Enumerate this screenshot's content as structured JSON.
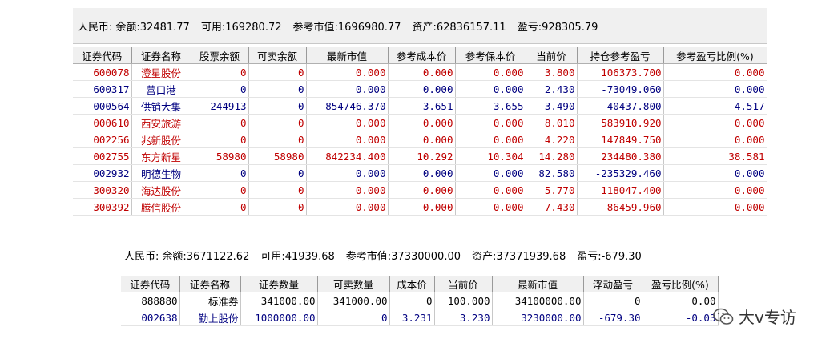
{
  "panel1": {
    "summary": {
      "currency": "人民币:",
      "balance": "余额:32481.77",
      "available": "可用:169280.72",
      "market_value": "参考市值:1696980.77",
      "assets": "资产:62836157.11",
      "profit": "盈亏:928305.79"
    },
    "headers": [
      "证券代码",
      "证券名称",
      "股票余额",
      "可卖余额",
      "最新市值",
      "参考成本价",
      "参考保本价",
      "当前价",
      "持仓参考盈亏",
      "参考盈亏比例(%)"
    ],
    "rows": [
      {
        "color": "red",
        "cells": [
          "600078",
          "澄星股份",
          "0",
          "0",
          "0.000",
          "0.000",
          "0.000",
          "3.800",
          "106373.700",
          "0.000"
        ]
      },
      {
        "color": "blue",
        "cells": [
          "600317",
          "营口港",
          "0",
          "0",
          "0.000",
          "0.000",
          "0.000",
          "2.430",
          "-73049.060",
          "0.000"
        ]
      },
      {
        "color": "blue",
        "cells": [
          "000564",
          "供销大集",
          "244913",
          "0",
          "854746.370",
          "3.651",
          "3.655",
          "3.490",
          "-40437.800",
          "-4.517"
        ]
      },
      {
        "color": "red",
        "cells": [
          "000610",
          "西安旅游",
          "0",
          "0",
          "0.000",
          "0.000",
          "0.000",
          "8.010",
          "583910.920",
          "0.000"
        ]
      },
      {
        "color": "red",
        "cells": [
          "002256",
          "兆新股份",
          "0",
          "0",
          "0.000",
          "0.000",
          "0.000",
          "4.220",
          "147849.750",
          "0.000"
        ]
      },
      {
        "color": "red",
        "cells": [
          "002755",
          "东方新星",
          "58980",
          "58980",
          "842234.400",
          "10.292",
          "10.304",
          "14.280",
          "234480.380",
          "38.581"
        ]
      },
      {
        "color": "blue",
        "cells": [
          "002932",
          "明德生物",
          "0",
          "0",
          "0.000",
          "0.000",
          "0.000",
          "82.580",
          "-235329.460",
          "0.000"
        ]
      },
      {
        "color": "red",
        "cells": [
          "300320",
          "海达股份",
          "0",
          "0",
          "0.000",
          "0.000",
          "0.000",
          "5.770",
          "118047.400",
          "0.000"
        ]
      },
      {
        "color": "red",
        "cells": [
          "300392",
          "腾信股份",
          "0",
          "0",
          "0.000",
          "0.000",
          "0.000",
          "7.430",
          "86459.960",
          "0.000"
        ]
      }
    ]
  },
  "panel2": {
    "summary": {
      "currency": "人民币:",
      "balance": "余额:3671122.62",
      "available": "可用:41939.68",
      "market_value": "参考市值:37330000.00",
      "assets": "资产:37371939.68",
      "profit": "盈亏:-679.30"
    },
    "headers": [
      "证券代码",
      "证券名称",
      "证券数量",
      "可卖数量",
      "成本价",
      "当前价",
      "最新市值",
      "浮动盈亏",
      "盈亏比例(%)"
    ],
    "rows": [
      {
        "color": "black",
        "cells": [
          "888880",
          "标准券",
          "341000.00",
          "341000.00",
          "0",
          "100.000",
          "34100000.00",
          "0",
          "0.00"
        ]
      },
      {
        "color": "blue",
        "cells": [
          "002638",
          "勤上股份",
          "1000000.00",
          "0",
          "3.231",
          "3.230",
          "3230000.00",
          "-679.30",
          "-0.03"
        ]
      }
    ]
  },
  "watermark": {
    "text": "大v专访",
    "icon": "wechat-icon"
  }
}
